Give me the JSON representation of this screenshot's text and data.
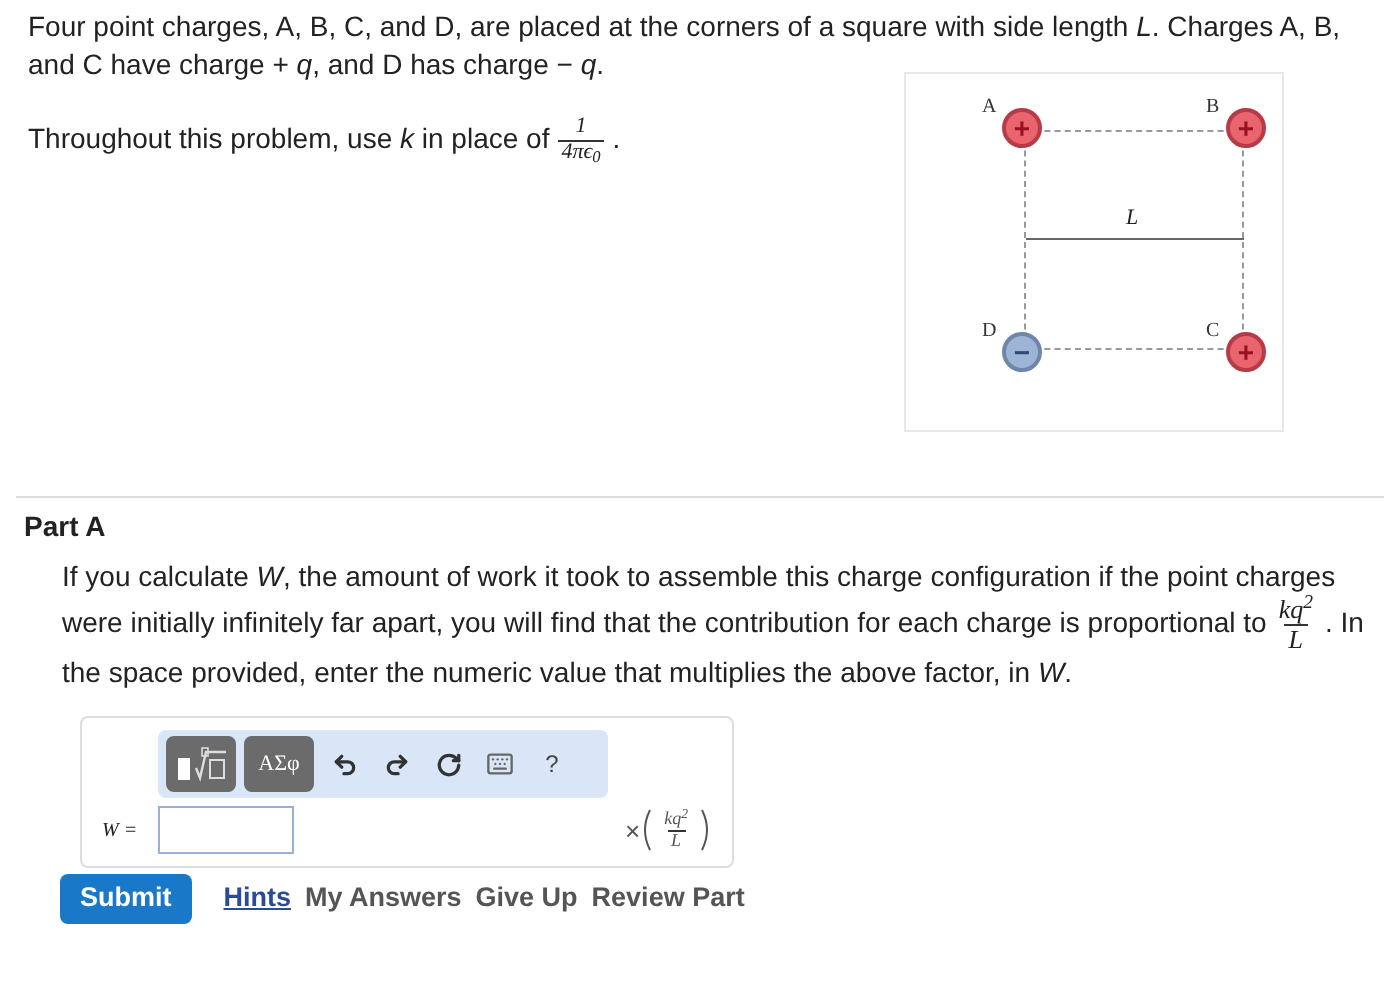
{
  "intro": "Four point charges, A, B, C, and D, are placed at the corners of a square with side length *L*. Charges A, B, and C have charge + *q*, and D has charge − *q*.",
  "instruction": {
    "before": "Throughout this problem, use *k* in place of",
    "numerator": "1",
    "denominator": "4πϵ$_{0}$",
    "after": "."
  },
  "diagram": {
    "side_label": "L",
    "charges": [
      {
        "label": "A",
        "sign": "+",
        "kind": "positive"
      },
      {
        "label": "B",
        "sign": "+",
        "kind": "positive"
      },
      {
        "label": "D",
        "sign": "−",
        "kind": "negative"
      },
      {
        "label": "C",
        "sign": "+",
        "kind": "positive"
      }
    ]
  },
  "part": {
    "title": "Part A",
    "before": "If you calculate *W*, the amount of work it took to assemble this charge configuration if the point charges were initially infinitely far apart, you will find that the contribution for each charge is proportional to",
    "numerator": "kq$^{2}$",
    "denominator": "L",
    "after": ". In the space provided, enter the numeric value that multiplies the above factor, in *W*."
  },
  "toolbar": [
    {
      "kind": "templates"
    },
    {
      "kind": "symbols",
      "label": "ΑΣφ"
    },
    {
      "kind": "undo"
    },
    {
      "kind": "redo"
    },
    {
      "kind": "reset"
    },
    {
      "kind": "keyboard"
    },
    {
      "kind": "help",
      "label": "?"
    }
  ],
  "answer": {
    "label": "W =",
    "times": "×",
    "numerator": "kq$^{2}$",
    "denominator": "L"
  },
  "actions": {
    "submit": "Submit",
    "links": [
      {
        "label": "Hints",
        "kind": "primary"
      },
      {
        "label": "My Answers",
        "kind": "secondary"
      },
      {
        "label": "Give Up",
        "kind": "secondary"
      },
      {
        "label": "Review Part",
        "kind": "secondary"
      }
    ]
  }
}
